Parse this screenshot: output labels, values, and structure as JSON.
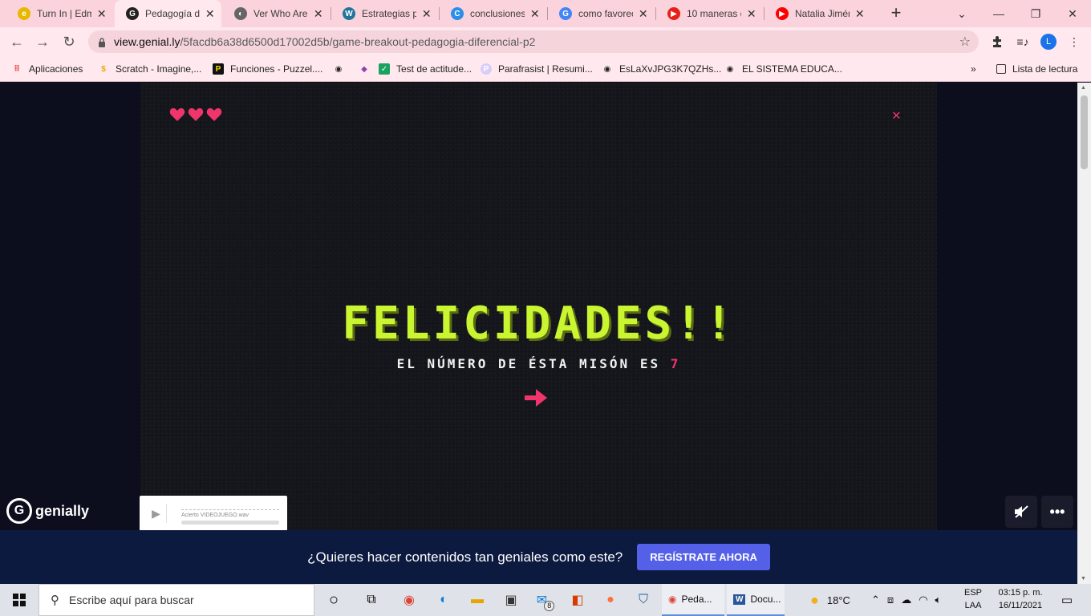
{
  "browser": {
    "tabs": [
      {
        "title": "Turn In | Edm",
        "icon": "edmodo-icon",
        "color": "#e8b800",
        "glyph": "e",
        "active": false
      },
      {
        "title": "Pedagogía di",
        "icon": "genially-icon",
        "color": "#222222",
        "glyph": "G",
        "active": true
      },
      {
        "title": "Ver Who Are",
        "icon": "globe-icon",
        "color": "#666666",
        "glyph": "◐",
        "active": false
      },
      {
        "title": "Estrategias p",
        "icon": "wordpress-icon",
        "color": "#21759b",
        "glyph": "W",
        "active": false
      },
      {
        "title": "conclusiones",
        "icon": "canva-icon",
        "color": "#2a8fe8",
        "glyph": "C",
        "active": false
      },
      {
        "title": "como favorec",
        "icon": "google-icon",
        "color": "#4285f4",
        "glyph": "G",
        "active": false
      },
      {
        "title": "10 maneras d",
        "icon": "youtube-shorts-icon",
        "color": "#e62117",
        "glyph": "▶",
        "active": false
      },
      {
        "title": "Natalia Jimén",
        "icon": "youtube-icon",
        "color": "#ff0000",
        "glyph": "▶",
        "active": false
      }
    ],
    "url_host": "view.genial.ly",
    "url_path": "/5facdb6a38d6500d17002d5b/game-breakout-pedagogia-diferencial-p2",
    "profile_initial": "L",
    "bookmarks": [
      {
        "label": "Aplicaciones",
        "icon": "apps-grid-icon"
      },
      {
        "label": "Scratch - Imagine,...",
        "icon": "scratch-icon"
      },
      {
        "label": "Funciones - Puzzel....",
        "icon": "puzzel-icon"
      },
      {
        "label": "",
        "icon": "globe-icon"
      },
      {
        "label": "",
        "icon": "gem-icon"
      },
      {
        "label": "Test de actitude...",
        "icon": "checkbox-icon"
      },
      {
        "label": "Parafrasist | Resumi...",
        "icon": "parafrasist-icon"
      },
      {
        "label": "EsLaXvJPG3K7QZHs...",
        "icon": "globe-icon"
      },
      {
        "label": "EL SISTEMA EDUCA...",
        "icon": "globe-icon"
      }
    ],
    "reading_list": "Lista de lectura"
  },
  "game": {
    "headline": "FELICIDADES!!",
    "subline_prefix": "EL NÚMERO DE ÉSTA MISÓN ES",
    "mission_number": "7",
    "lives": 3,
    "accent": "#f0346c",
    "headline_color": "#c9f531"
  },
  "player": {
    "file_name": "Acierto VIDEOJUEGO.wav"
  },
  "genially": {
    "brand": "genially",
    "cta_text": "¿Quieres hacer contenidos tan geniales como este?",
    "cta_button": "REGÍSTRATE AHORA"
  },
  "taskbar": {
    "search_placeholder": "Escribe aquí para buscar",
    "apps": [
      {
        "label": "Peda...",
        "icon": "chrome-icon"
      },
      {
        "label": "Docu...",
        "icon": "word-icon"
      }
    ],
    "mail_badge": "8",
    "weather": "18°C",
    "lang_top": "ESP",
    "lang_bottom": "LAA",
    "time": "03:15 p. m.",
    "date": "16/11/2021"
  }
}
